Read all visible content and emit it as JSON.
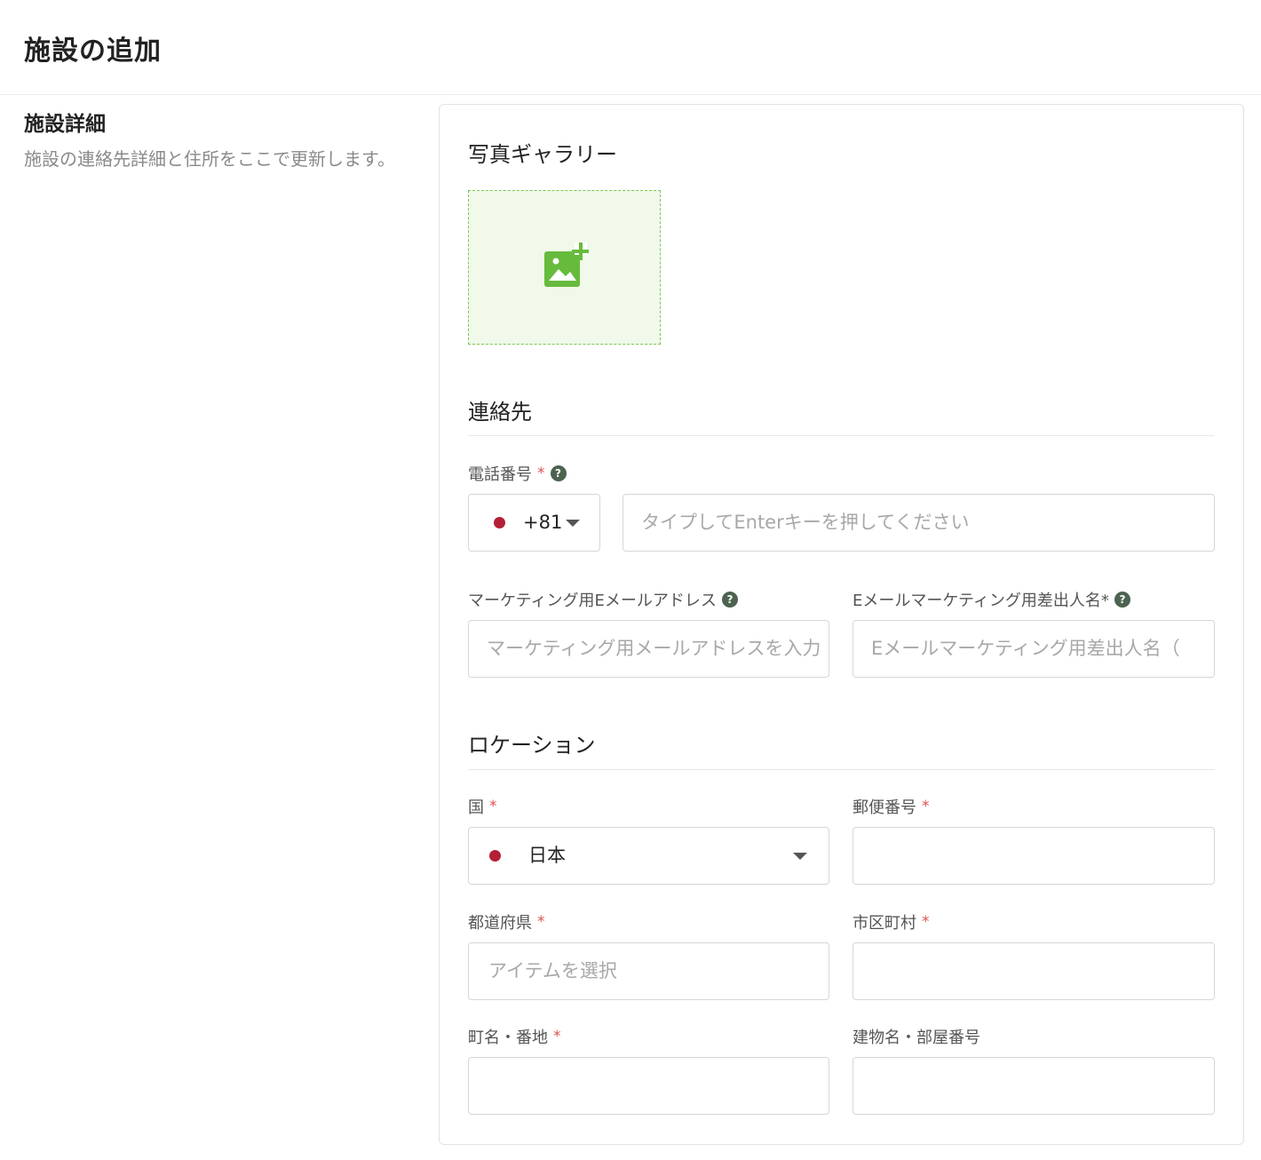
{
  "page": {
    "title": "施設の追加"
  },
  "side": {
    "title": "施設詳細",
    "description": "施設の連絡先詳細と住所をここで更新します。"
  },
  "gallery": {
    "title": "写真ギャラリー",
    "upload_icon": "add-photo-icon",
    "accent": "#7cc656"
  },
  "contact": {
    "title": "連絡先",
    "phone": {
      "label": "電話番号",
      "required": "*",
      "help": "?",
      "country_code": "+81",
      "flag": "japan-flag-icon",
      "placeholder": "タイプしてEnterキーを押してください"
    },
    "marketing_email": {
      "label": "マーケティング用Eメールアドレス",
      "help": "?",
      "placeholder": "マーケティング用メールアドレスを入力"
    },
    "sender_name": {
      "label": "Eメールマーケティング用差出人名*",
      "help": "?",
      "placeholder": "Eメールマーケティング用差出人名（"
    }
  },
  "location": {
    "title": "ロケーション",
    "country": {
      "label": "国",
      "required": "*",
      "value": "日本",
      "flag": "japan-flag-icon"
    },
    "postal_code": {
      "label": "郵便番号",
      "required": "*",
      "value": ""
    },
    "prefecture": {
      "label": "都道府県",
      "required": "*",
      "placeholder": "アイテムを選択"
    },
    "city": {
      "label": "市区町村",
      "required": "*",
      "value": ""
    },
    "street": {
      "label": "町名・番地",
      "required": "*",
      "value": ""
    },
    "building": {
      "label": "建物名・部屋番号",
      "value": ""
    }
  },
  "colors": {
    "required": "#e05050",
    "help_icon_bg": "#4d6350",
    "flag_dot": "#b51f36"
  }
}
